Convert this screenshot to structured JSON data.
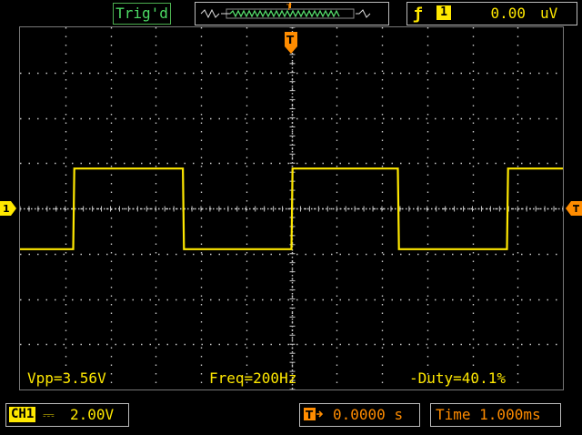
{
  "header": {
    "run_status": "Trig'd",
    "trigger_source_channel": "1",
    "trigger_level": "0.00",
    "trigger_level_unit": "uV",
    "trigger_edge_icon": "rising-edge-icon",
    "trigger_marker": "T"
  },
  "channel": {
    "label": "CH1",
    "coupling_icon": "dc-coupling-icon",
    "coupling_symbol": "⎓",
    "volts_per_div": "2.00V",
    "ground_marker": "1",
    "trace_color": "#ffe800"
  },
  "measurements": {
    "vpp": "Vpp=3.56V",
    "freq": "Freq=200Hz",
    "duty": "-Duty=40.1%"
  },
  "timebase": {
    "position_icon": "trigger-position-icon",
    "position": "0.0000",
    "position_unit": "s",
    "time_per_div": "Time 1.000ms"
  },
  "colors": {
    "trace": "#ffe800",
    "accent": "#ff8c00",
    "status": "#4cd964",
    "grid": "#c8c8c8"
  },
  "chart_data": {
    "type": "line",
    "title": "",
    "xlabel": "",
    "ylabel": "",
    "x_unit": "ms",
    "y_unit": "V",
    "xlim": [
      -5,
      5
    ],
    "ylim": [
      -8,
      8
    ],
    "series": [
      {
        "values_x": [
          -5.0,
          -4.02,
          -4.0,
          -2.0,
          -1.98,
          0.0,
          0.02,
          1.96,
          1.98,
          3.97,
          3.99,
          5.0
        ],
        "values_y": [
          -1.8,
          -1.8,
          1.76,
          1.76,
          -1.8,
          -1.8,
          1.76,
          1.76,
          -1.8,
          -1.8,
          1.76,
          1.76
        ]
      }
    ]
  }
}
